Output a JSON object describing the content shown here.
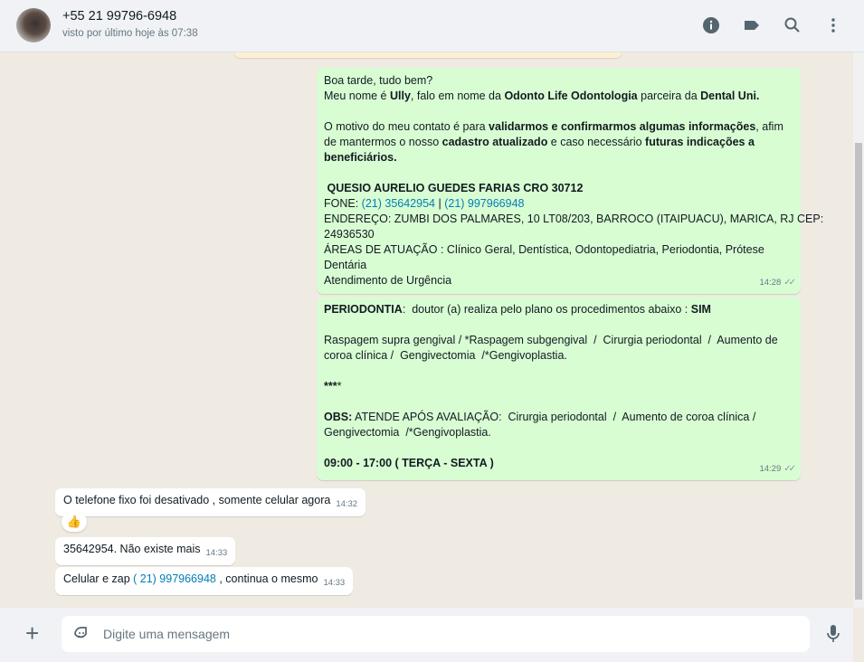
{
  "header": {
    "contact": "+55 21 99796-6948",
    "status": "visto por último hoje às 07:38",
    "icons": [
      "info-icon",
      "label-icon",
      "search-icon",
      "menu-icon"
    ]
  },
  "messages_out": [
    {
      "time": "14:28",
      "lines": [
        [
          {
            "t": "Boa tarde, tudo bem?"
          }
        ],
        [
          {
            "t": "Meu nome é "
          },
          {
            "t": "Ully",
            "b": 1
          },
          {
            "t": ", falo em nome da "
          },
          {
            "t": "Odonto Life Odontologia",
            "b": 1
          },
          {
            "t": " parceira da "
          },
          {
            "t": "Dental Uni.",
            "b": 1
          }
        ],
        [],
        [
          {
            "t": "O motivo do meu contato é para "
          },
          {
            "t": "validarmos e confirmarmos algumas informações",
            "b": 1
          },
          {
            "t": ", afim"
          }
        ],
        [
          {
            "t": "de mantermos o nosso "
          },
          {
            "t": "cadastro atualizado",
            "b": 1
          },
          {
            "t": " e caso necessário "
          },
          {
            "t": "futuras indicações a",
            "b": 1
          }
        ],
        [
          {
            "t": "beneficiários.",
            "b": 1
          }
        ],
        [],
        [
          {
            "t": " QUESIO AURELIO GUEDES FARIAS CRO 30712",
            "b": 1
          }
        ],
        [
          {
            "t": "FONE: "
          },
          {
            "t": "(21) 35642954",
            "l": 1
          },
          {
            "t": " | "
          },
          {
            "t": "(21) 997966948",
            "l": 1
          }
        ],
        [
          {
            "t": "ENDEREÇO: ZUMBI DOS PALMARES, 10 LT08/203, BARROCO (ITAIPUACU), MARICA, RJ CEP:"
          }
        ],
        [
          {
            "t": "24936530"
          }
        ],
        [
          {
            "t": "ÁREAS DE ATUAÇÃO : Clínico Geral, Dentística, Odontopediatria, Periodontia, Prótese"
          }
        ],
        [
          {
            "t": "Dentária"
          }
        ],
        [
          {
            "t": "Atendimento de Urgência"
          }
        ]
      ]
    },
    {
      "time": "14:29",
      "lines": [
        [
          {
            "t": "PERIODONTIA",
            "b": 1
          },
          {
            "t": ":  doutor (a) realiza pelo plano os procedimentos abaixo : "
          },
          {
            "t": "SIM",
            "b": 1
          }
        ],
        [],
        [
          {
            "t": "Raspagem supra gengival / *Raspagem subgengival  /  Cirurgia periodontal  /  Aumento de"
          }
        ],
        [
          {
            "t": "coroa clínica /  Gengivectomia  /*Gengivoplastia."
          }
        ],
        [],
        [
          {
            "t": "***",
            "b": 1
          },
          {
            "t": "*"
          }
        ],
        [],
        [
          {
            "t": "OBS:",
            "b": 1
          },
          {
            "t": " ATENDE APÓS AVALIAÇÃO:  Cirurgia periodontal  /  Aumento de coroa clínica /"
          }
        ],
        [
          {
            "t": "Gengivectomia  /*Gengivoplastia."
          }
        ],
        [],
        [
          {
            "t": "09:00 - 17:00 ( TERÇA - SEXTA )",
            "b": 1
          }
        ]
      ]
    }
  ],
  "messages_in": [
    {
      "text": "O telefone fixo foi desativado , somente celular agora",
      "time": "14:32",
      "reaction": "👍"
    },
    {
      "text": "35642954.  Não existe mais",
      "time": "14:33"
    },
    {
      "pre": "Celular e zap ",
      "link": "( 21) 997966948",
      "post": " , continua o mesmo",
      "time": "14:33"
    }
  ],
  "footer": {
    "placeholder": "Digite uma mensagem",
    "plus": "+"
  }
}
